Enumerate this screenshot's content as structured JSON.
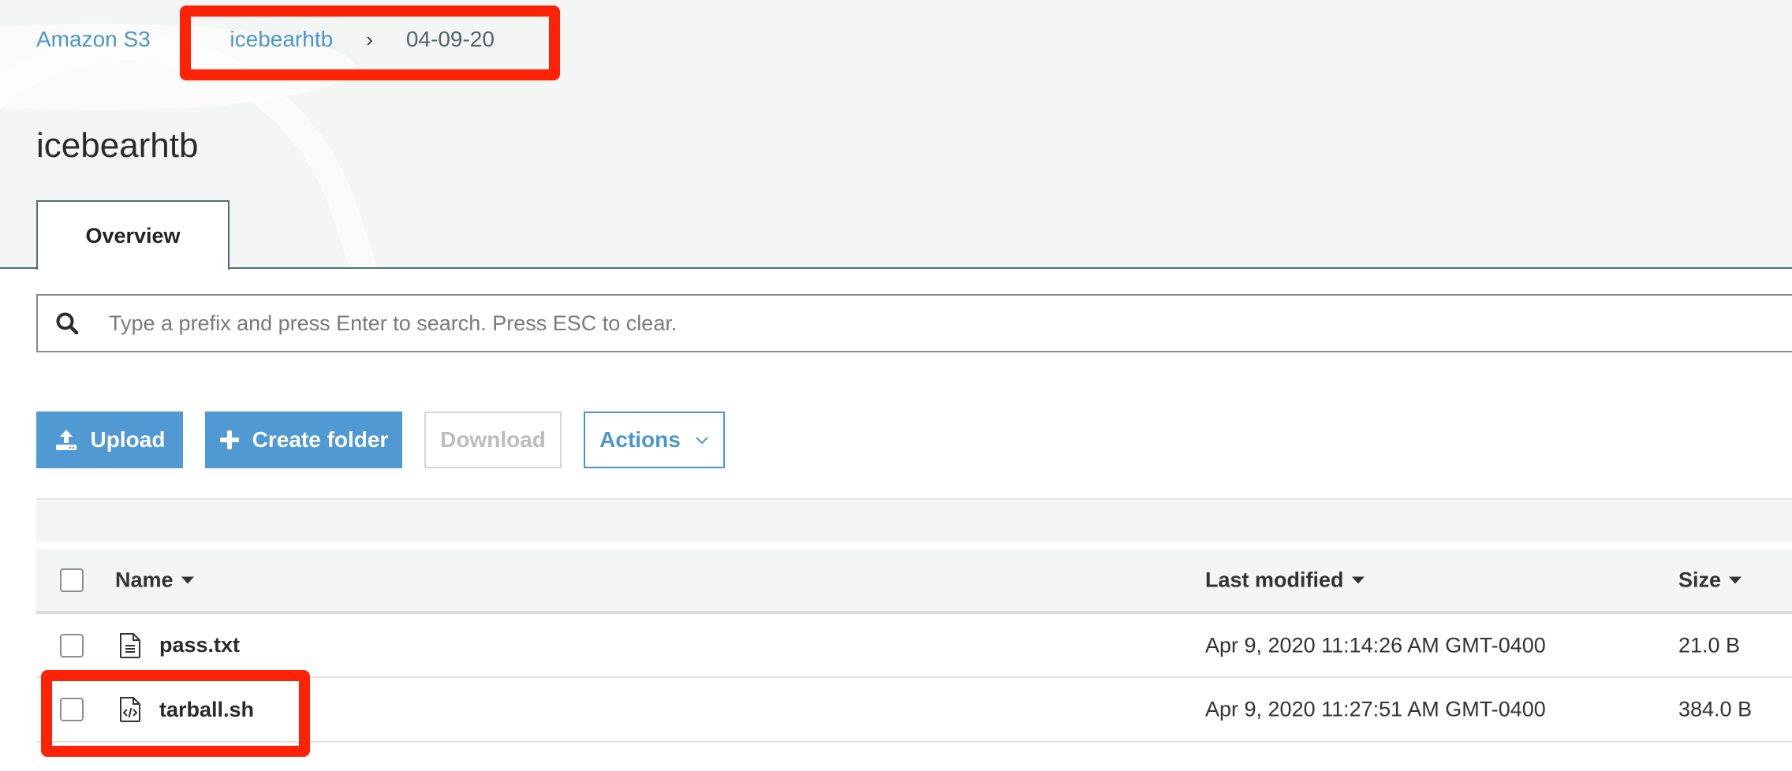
{
  "breadcrumb": {
    "items": [
      {
        "label": "Amazon S3",
        "type": "link"
      },
      {
        "label": "icebearhtb",
        "type": "link"
      },
      {
        "label": "04-09-20",
        "type": "current"
      }
    ],
    "separator": "›"
  },
  "page": {
    "title": "icebearhtb"
  },
  "tabs": [
    {
      "label": "Overview",
      "active": true
    }
  ],
  "search": {
    "placeholder": "Type a prefix and press Enter to search. Press ESC to clear.",
    "value": "",
    "icon": "search-icon"
  },
  "toolbar": {
    "upload_label": "Upload",
    "upload_icon": "upload-icon",
    "create_folder_label": "Create folder",
    "create_folder_icon": "plus-icon",
    "download_label": "Download",
    "download_disabled": true,
    "actions_label": "Actions",
    "actions_icon": "chevron-down-icon"
  },
  "table": {
    "columns": [
      {
        "label": "Name",
        "sort_icon": "caret-down-icon"
      },
      {
        "label": "Last modified",
        "sort_icon": "caret-down-icon"
      },
      {
        "label": "Size",
        "sort_icon": "caret-down-icon"
      }
    ],
    "rows": [
      {
        "name": "pass.txt",
        "icon": "text-file-icon",
        "last_modified": "Apr 9, 2020 11:14:26 AM GMT-0400",
        "size": "21.0 B",
        "checked": false
      },
      {
        "name": "tarball.sh",
        "icon": "code-file-icon",
        "last_modified": "Apr 9, 2020 11:27:51 AM GMT-0400",
        "size": "384.0 B",
        "checked": false
      }
    ]
  },
  "annotations": {
    "color": "#fe2306",
    "highlighted": [
      "breadcrumb icebearhtb › 04-09-20",
      "tarball.sh row"
    ]
  },
  "colors": {
    "link": "#4c96cc",
    "primary_button": "#5199d2",
    "header_background": "#f4f6f5",
    "tab_border": "#546b7a"
  }
}
